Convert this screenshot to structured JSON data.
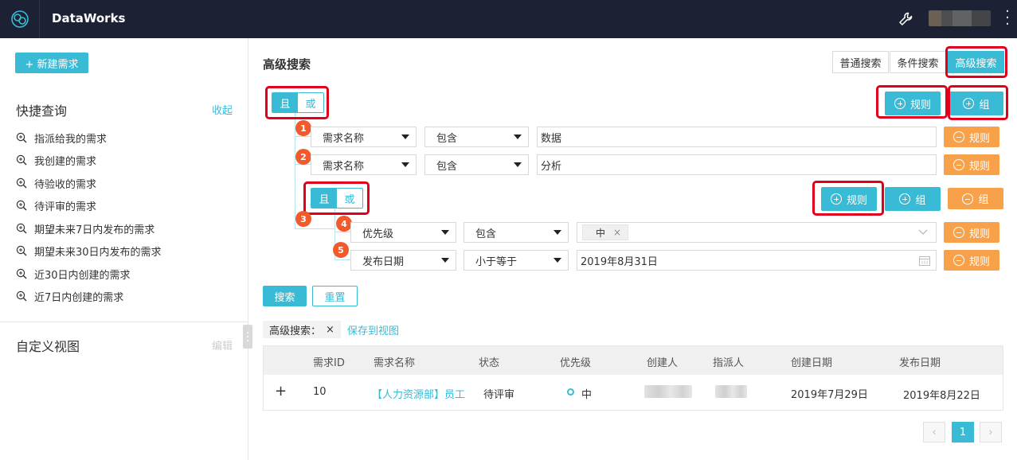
{
  "app": {
    "title": "DataWorks"
  },
  "header": {
    "icons": [
      "logo-icon",
      "wrench-icon",
      "more-vertical-icon"
    ]
  },
  "sidebar": {
    "new_button": "+ 新建需求",
    "quick_title": "快捷查询",
    "collapse_label": "收起",
    "quick_items": [
      "指派给我的需求",
      "我创建的需求",
      "待验收的需求",
      "待评审的需求",
      "期望未来7日内发布的需求",
      "期望未来30日内发布的需求",
      "近30日内创建的需求",
      "近7日内创建的需求"
    ],
    "custom_title": "自定义视图",
    "edit_label": "编辑"
  },
  "main": {
    "title": "高级搜索",
    "search_modes": [
      "普通搜索",
      "条件搜索",
      "高级搜索"
    ],
    "active_mode": "高级搜索",
    "and_label": "且",
    "or_label": "或",
    "add_rule": "规则",
    "add_group": "组",
    "remove_rule": "规则",
    "remove_group": "组",
    "rules": [
      {
        "index": "1",
        "field": "需求名称",
        "op": "包含",
        "value": "数据"
      },
      {
        "index": "2",
        "field": "需求名称",
        "op": "包含",
        "value": "分析"
      }
    ],
    "group": {
      "index": "3",
      "rules": [
        {
          "index": "4",
          "field": "优先级",
          "op": "包含",
          "tag": "中",
          "tag_close": "×"
        },
        {
          "index": "5",
          "field": "发布日期",
          "op": "小于等于",
          "value": "2019年8月31日"
        }
      ]
    },
    "search_button": "搜索",
    "reset_button": "重置",
    "filter_tag": "高级搜索：",
    "filter_close": "×",
    "save_view": "保存到视图"
  },
  "table": {
    "columns": [
      "需求ID",
      "需求名称",
      "状态",
      "优先级",
      "创建人",
      "指派人",
      "创建日期",
      "发布日期"
    ],
    "rows": [
      {
        "expand": "+",
        "id": "10",
        "name": "【人力资源部】员工",
        "status": "待评审",
        "priority": "中",
        "created": "2019年7月29日",
        "release": "2019年8月22日"
      }
    ]
  },
  "pagination": {
    "prev": "‹",
    "current": "1",
    "next": "›"
  },
  "colors": {
    "accent": "#39bbd6",
    "warning": "#f7a24a",
    "topbar": "#1c2233",
    "badge": "#f25a2c",
    "highlight": "#e0001b"
  }
}
